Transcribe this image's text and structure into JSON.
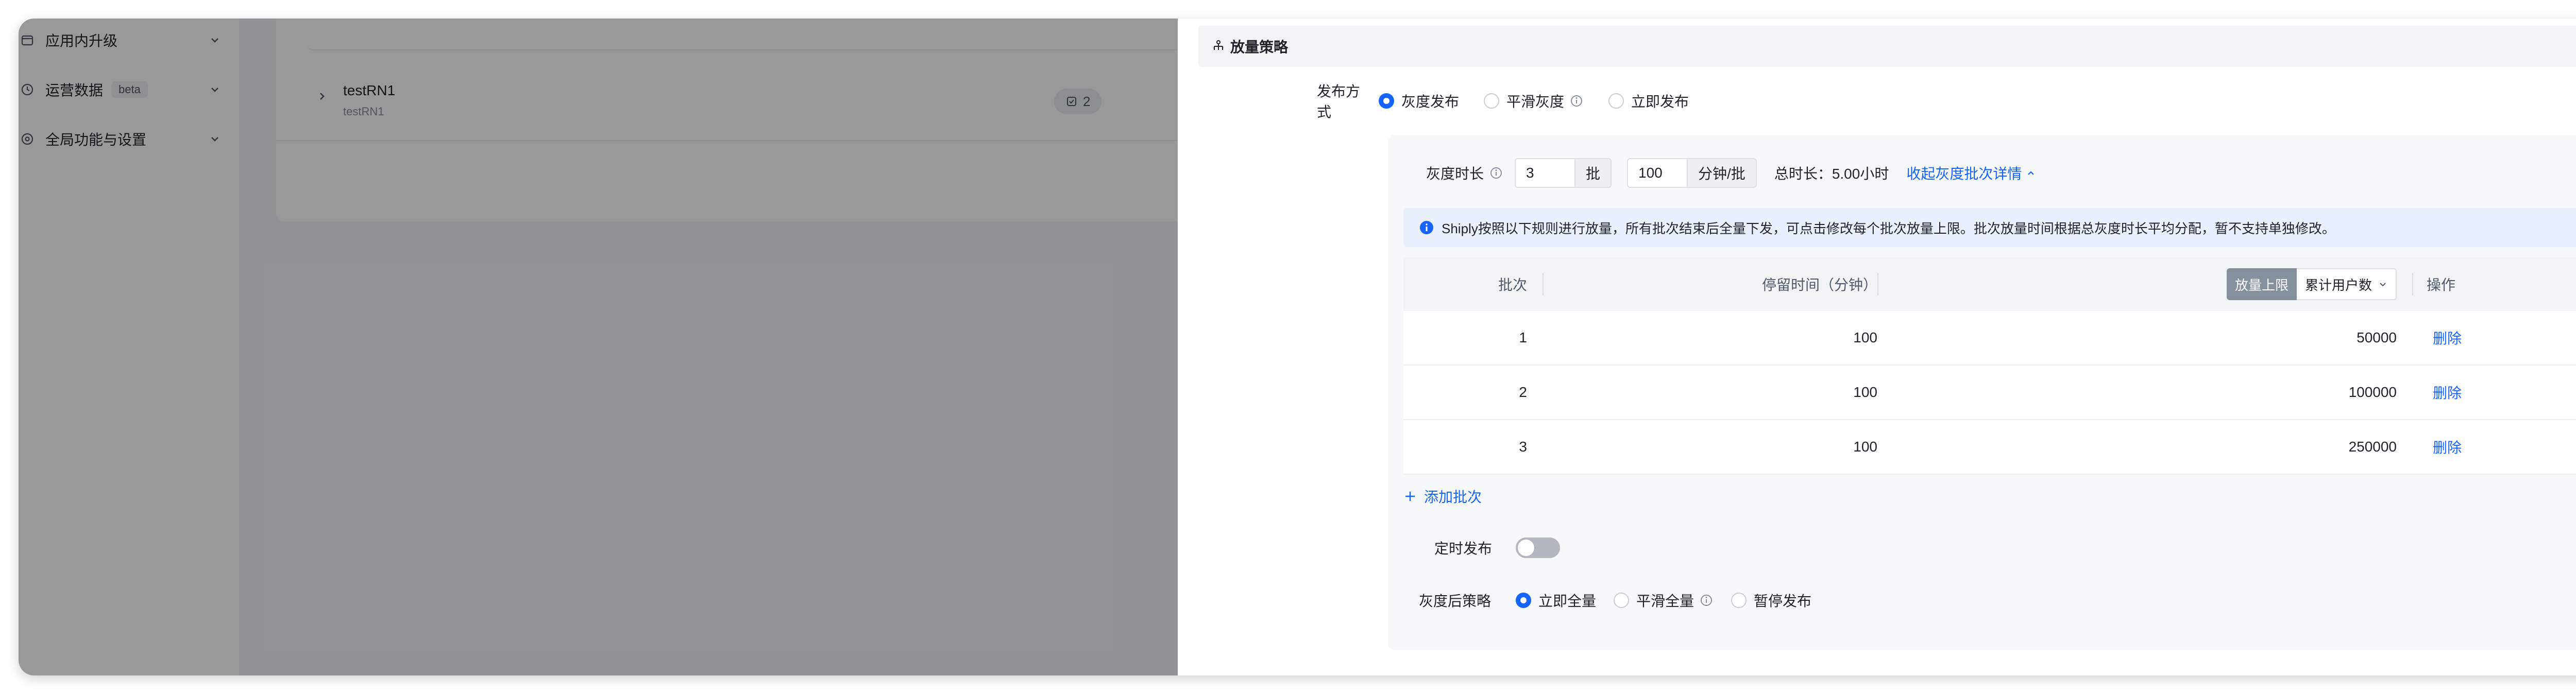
{
  "sidebar": {
    "items": [
      {
        "label": "应用内升级",
        "icon": "upgrade-icon"
      },
      {
        "label": "运营数据",
        "badge": "beta",
        "icon": "clock-icon"
      },
      {
        "label": "全局功能与设置",
        "icon": "settings-icon"
      }
    ]
  },
  "background_list": {
    "row": {
      "name": "testRN1",
      "sub": "testRN1",
      "count": "2"
    }
  },
  "drawer": {
    "section_title": "放量策略",
    "publish_mode": {
      "label": "发布方式",
      "options": [
        "灰度发布",
        "平滑灰度",
        "立即发布"
      ],
      "selected": "灰度发布"
    },
    "gray_duration": {
      "label": "灰度时长",
      "batches_value": "3",
      "batches_unit": "批",
      "minutes_value": "100",
      "minutes_unit": "分钟/批",
      "total_label": "总时长：",
      "total_value": "5.00小时",
      "collapse_link": "收起灰度批次详情"
    },
    "alert_text": "Shiply按照以下规则进行放量，所有批次结束后全量下发，可点击修改每个批次放量上限。批次放量时间根据总灰度时长平均分配，暂不支持单独修改。",
    "table": {
      "headers": {
        "batch": "批次",
        "stay": "停留时间（分钟）",
        "cap_tag": "放量上限",
        "cap_select": "累计用户数",
        "action": "操作"
      },
      "rows": [
        {
          "batch": "1",
          "stay": "100",
          "cap": "50000",
          "action": "删除"
        },
        {
          "batch": "2",
          "stay": "100",
          "cap": "100000",
          "action": "删除"
        },
        {
          "batch": "3",
          "stay": "100",
          "cap": "250000",
          "action": "删除"
        }
      ]
    },
    "add_batch": "添加批次",
    "scheduled": {
      "label": "定时发布",
      "on": false
    },
    "post_strategy": {
      "label": "灰度后策略",
      "options": [
        "立即全量",
        "平滑全量",
        "暂停发布"
      ],
      "selected": "立即全量"
    }
  },
  "colors": {
    "accent": "#1664ff",
    "overlay": "rgba(0,0,0,0.40)"
  }
}
